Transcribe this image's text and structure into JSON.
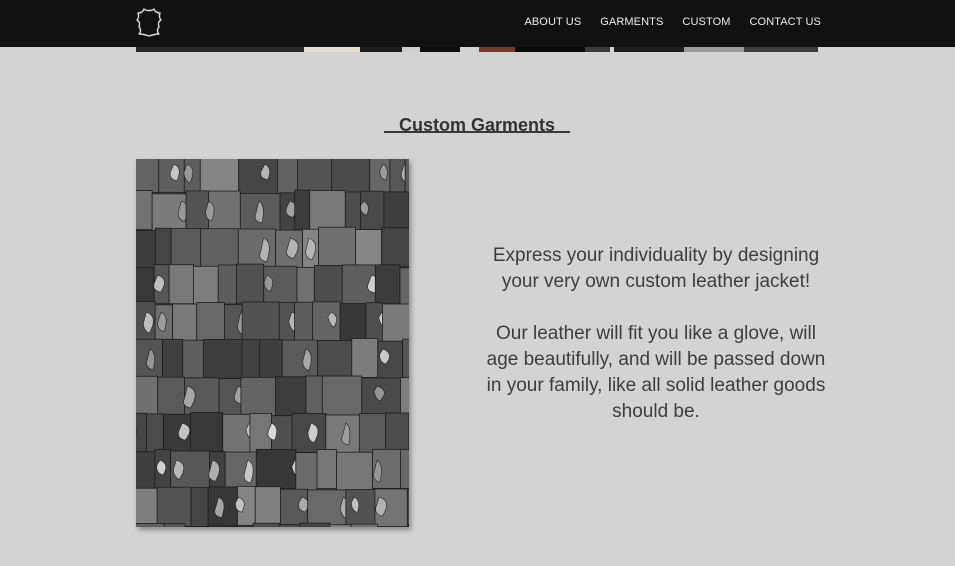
{
  "nav": {
    "logo_icon": "leather-hide-icon",
    "links": [
      {
        "label": "ABOUT US"
      },
      {
        "label": "GARMENTS"
      },
      {
        "label": "CUSTOM"
      },
      {
        "label": "CONTACT US"
      }
    ]
  },
  "section": {
    "title": "Custom Garments",
    "image_icon": "leather-patchwork-image",
    "paragraphs": [
      "Express your individuality by designing your very own custom leather jacket!",
      "Our leather will fit you like a glove, will age beautifully, and will be passed down in your family, like all solid leather goods should be."
    ]
  },
  "colors": {
    "nav_bg": "#111111",
    "page_bg": "#d3d3d3",
    "text": "#3d3d3d"
  }
}
